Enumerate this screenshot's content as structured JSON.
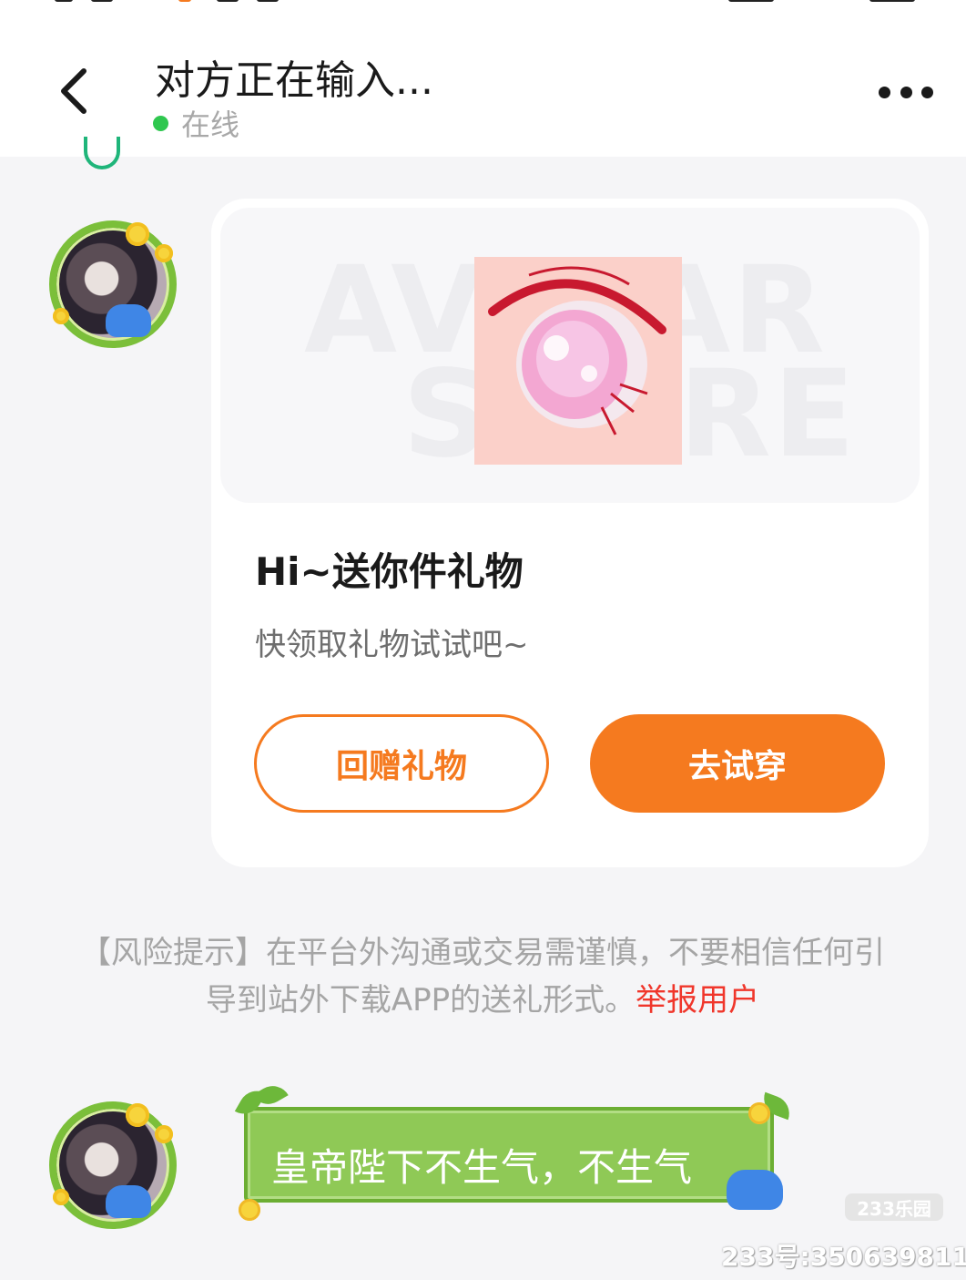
{
  "header": {
    "title": "对方正在输入...",
    "status": "在线",
    "status_color": "#2fc74f"
  },
  "gift_card": {
    "watermark_line1": "AVATAR",
    "watermark_line2": "STORE",
    "title": "Hi~送你件礼物",
    "subtitle": "快领取礼物试试吧~",
    "return_gift_label": "回赠礼物",
    "try_on_label": "去试穿",
    "accent_color": "#f57a1f"
  },
  "risk_notice": {
    "text": "【风险提示】在平台外沟通或交易需谨慎，不要相信任何引导到站外下载APP的送礼形式。",
    "report_link": "举报用户",
    "report_color": "#f0362b"
  },
  "messages": [
    {
      "text": "皇帝陛下不生气，不生气"
    }
  ],
  "watermark": {
    "brand": "233乐园",
    "user_id": "233号:350639811"
  }
}
